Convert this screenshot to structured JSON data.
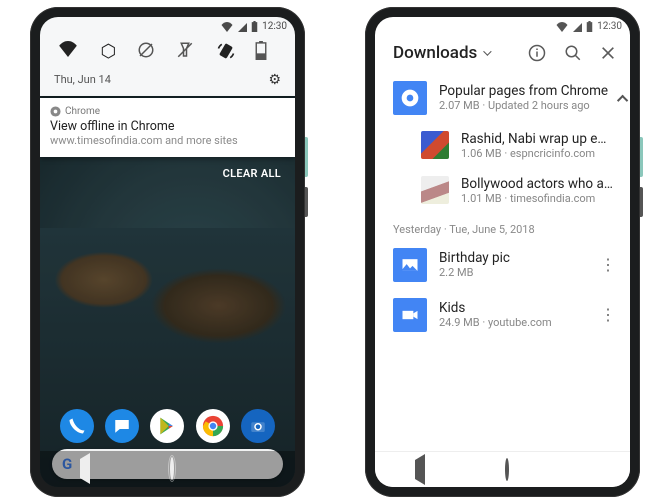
{
  "left": {
    "status": {
      "time": "12:30"
    },
    "qs_date": "Thu, Jun 14",
    "notification": {
      "app": "Chrome",
      "title": "View offline in Chrome",
      "subtitle": "www.timesofindia.com and more sites"
    },
    "clear_all": "CLEAR ALL"
  },
  "right": {
    "status": {
      "time": "12:30"
    },
    "header": {
      "title": "Downloads"
    },
    "group": {
      "title": "Popular pages from Chrome",
      "subtitle": "2.07 MB · Updated 2 hours ago",
      "items": [
        {
          "title": "Rashid, Nabi wrap up emph…",
          "subtitle": "1.06 MB · espncricinfo.com"
        },
        {
          "title": "Bollywood actors who are d…",
          "subtitle": "1.01 MB · timesofindia.com"
        }
      ]
    },
    "section_date": "Yesterday · Tue, June 5, 2018",
    "items": [
      {
        "title": "Birthday pic",
        "subtitle": "2.2 MB"
      },
      {
        "title": "Kids",
        "subtitle": "24.9 MB · youtube.com"
      }
    ]
  }
}
